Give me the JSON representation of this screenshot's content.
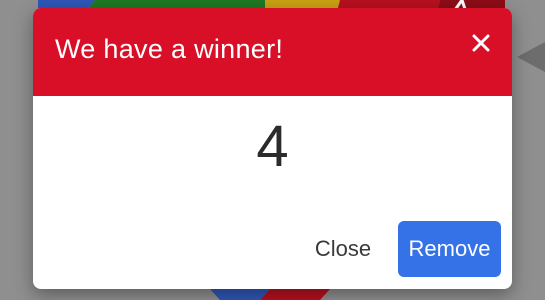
{
  "backdrop": {
    "overlay_color": "#8f8f8f",
    "wheel_segment_colors": [
      "#2f57b8",
      "#1e7a23",
      "#c9a214",
      "#b8101f",
      "#8c0d17"
    ],
    "pointer_color": "#6d6d6d"
  },
  "dialog": {
    "title": "We have a winner!",
    "header_color": "#d90f27",
    "close_icon": "close-x-icon",
    "winner": "4",
    "close_label": "Close",
    "remove_label": "Remove",
    "remove_color": "#3572e8"
  }
}
